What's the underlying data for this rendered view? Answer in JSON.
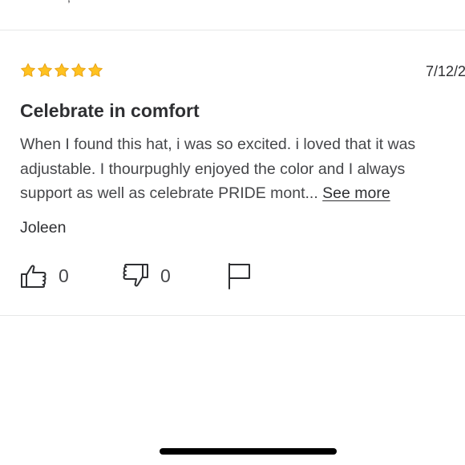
{
  "review": {
    "rating": 5,
    "rating_max": 5,
    "date": "7/12/2",
    "title": "Celebrate in comfort",
    "body_lines": [
      "When I found this hat, i was so excited. i loved that it was",
      "adjustable. I thourpughly enjoyed the color and I always",
      "support as well as celebrate PRIDE mont..."
    ],
    "see_more_label": "See more",
    "author": "Joleen",
    "helpful_count": "0",
    "unhelpful_count": "0"
  },
  "icons": {
    "star": "star-icon",
    "helpful": "thumbs-up-icon",
    "unhelpful": "thumbs-down-icon",
    "report": "flag-icon"
  },
  "colors": {
    "star_fill": "#ffc220",
    "star_stroke": "#e8a317",
    "text_primary": "#2e2f32",
    "text_secondary": "#46474a",
    "divider": "#e6e7e8",
    "home_indicator": "#000000"
  }
}
